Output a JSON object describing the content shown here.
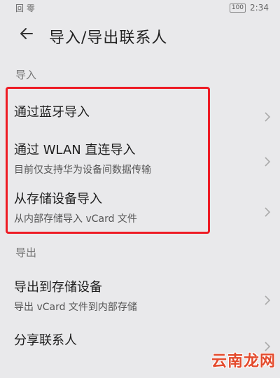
{
  "status_bar": {
    "left_text": "回 零",
    "battery": "100",
    "time": "2:34"
  },
  "header": {
    "title": "导入/导出联系人",
    "back_icon": "arrow-left-icon"
  },
  "sections": {
    "import_label": "导入",
    "export_label": "导出"
  },
  "import_items": [
    {
      "title": "通过蓝牙导入",
      "subtitle": ""
    },
    {
      "title": "通过 WLAN 直连导入",
      "subtitle": "目前仅支持华为设备间数据传输"
    },
    {
      "title": "从存储设备导入",
      "subtitle": "从内部存储导入 vCard 文件"
    }
  ],
  "export_items": [
    {
      "title": "导出到存储设备",
      "subtitle": "导出 vCard 文件到内部存储"
    },
    {
      "title": "分享联系人",
      "subtitle": ""
    }
  ],
  "watermark": "云南龙网",
  "colors": {
    "highlight": "#ee1c25",
    "watermark": "#e34a2c"
  }
}
